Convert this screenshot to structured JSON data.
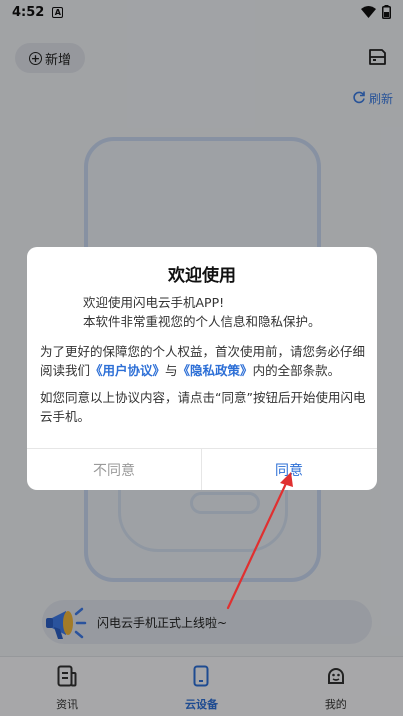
{
  "status_bar": {
    "time": "4:52",
    "notification_letter": "A"
  },
  "header": {
    "add_button_label": "新增",
    "refresh_label": "刷新"
  },
  "announcement": {
    "text": "闪电云手机正式上线啦~"
  },
  "bottom_nav": {
    "tabs": [
      {
        "label": "资讯",
        "icon": "document-icon",
        "active": false
      },
      {
        "label": "云设备",
        "icon": "phone-icon",
        "active": true
      },
      {
        "label": "我的",
        "icon": "profile-icon",
        "active": false
      }
    ]
  },
  "dialog": {
    "title": "欢迎使用",
    "intro_line1": "欢迎使用闪电云手机APP!",
    "intro_line2": "本软件非常重视您的个人信息和隐私保护。",
    "para1_part1": "为了更好的保障您的个人权益，首次使用前，请您务必仔细阅读我们",
    "user_agreement_link": "《用户协议》",
    "para1_and": "与",
    "privacy_policy_link": "《隐私政策》",
    "para1_part2": "内的全部条款。",
    "para2": "如您同意以上协议内容，请点击“同意”按钮后开始使用闪电云手机。",
    "disagree_label": "不同意",
    "agree_label": "同意"
  },
  "colors": {
    "accent": "#2d6fd6",
    "annotation_arrow": "#e03030"
  }
}
